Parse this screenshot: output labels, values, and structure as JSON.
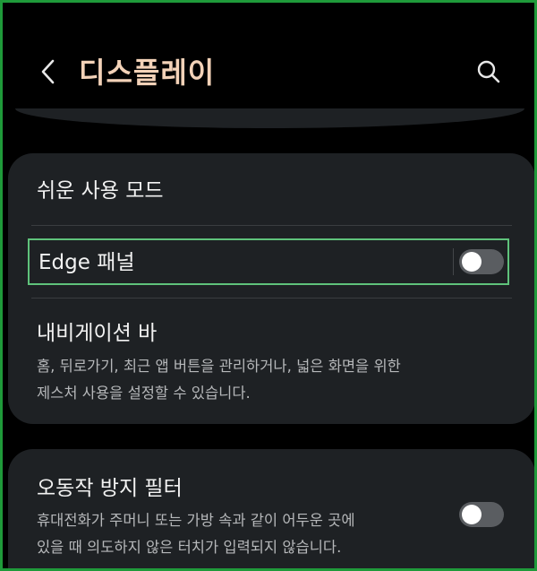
{
  "header": {
    "title": "디스플레이",
    "back_icon": "chevron-left-icon",
    "search_icon": "search-icon",
    "title_color": "#f3d2b8"
  },
  "settings": {
    "easy_mode": {
      "title": "쉬운 사용 모드"
    },
    "edge_panels": {
      "title": "Edge 패널",
      "enabled": false
    },
    "navigation_bar": {
      "title": "내비게이션 바",
      "description_line1": "홈, 뒤로가기, 최근 앱 버튼을 관리하거나, 넓은 화면을 위한",
      "description_line2": "제스처 사용을 설정할 수 있습니다."
    },
    "accidental_touch": {
      "title": "오동작 방지 필터",
      "description_line1": "휴대전화가 주머니 또는 가방 속과 같이 어두운 곳에",
      "description_line2": "있을 때 의도하지 않은 터치가 입력되지 않습니다.",
      "enabled": false
    }
  },
  "colors": {
    "background": "#000000",
    "card": "#1e2124",
    "focus_outline": "#5fc27b",
    "frame_border": "#1f9a3a",
    "toggle_off": "#5a5d61"
  }
}
